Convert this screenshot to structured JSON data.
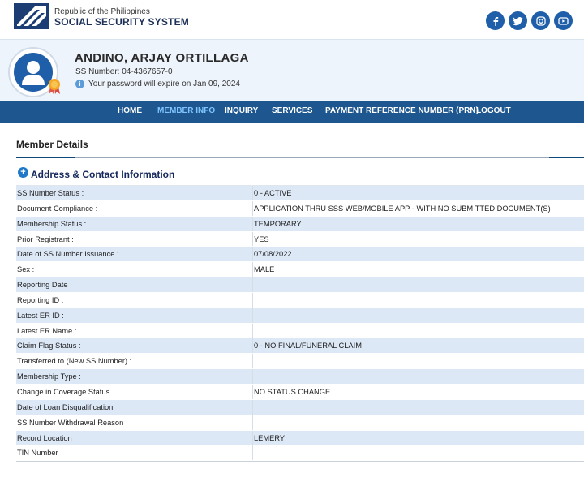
{
  "header": {
    "brand_line1": "Republic of the Philippines",
    "brand_line2": "SOCIAL SECURITY SYSTEM",
    "social_icons": [
      "facebook-icon",
      "twitter-icon",
      "instagram-icon",
      "youtube-icon"
    ]
  },
  "profile": {
    "name": "ANDINO, ARJAY ORTILLAGA",
    "ss_number": "SS Number: 04-4367657-0",
    "password_notice": "Your password will expire on Jan 09, 2024"
  },
  "nav": {
    "items": [
      {
        "label": "HOME"
      },
      {
        "label": "MEMBER INFO",
        "active": true
      },
      {
        "label": "INQUIRY"
      },
      {
        "label": "SERVICES"
      },
      {
        "label": "PAYMENT REFERENCE NUMBER (PRN)"
      },
      {
        "label": "LOGOUT"
      }
    ]
  },
  "main": {
    "section_title": "Member Details",
    "subsection_title": "Address & Contact Information",
    "rows": [
      {
        "label": "SS Number Status :",
        "value": "0 - ACTIVE"
      },
      {
        "label": "Document Compliance :",
        "value": "APPLICATION THRU SSS WEB/MOBILE APP - WITH NO SUBMITTED DOCUMENT(S)"
      },
      {
        "label": "Membership Status :",
        "value": "TEMPORARY"
      },
      {
        "label": "Prior Registrant :",
        "value": "YES"
      },
      {
        "label": "Date of SS Number Issuance :",
        "value": "07/08/2022"
      },
      {
        "label": "Sex :",
        "value": "MALE"
      },
      {
        "label": "Reporting Date :",
        "value": ""
      },
      {
        "label": "Reporting ID :",
        "value": ""
      },
      {
        "label": "Latest ER ID :",
        "value": ""
      },
      {
        "label": "Latest ER Name :",
        "value": ""
      },
      {
        "label": "Claim Flag Status :",
        "value": "0 - NO FINAL/FUNERAL CLAIM"
      },
      {
        "label": "Transferred to (New SS Number) :",
        "value": ""
      },
      {
        "label": "Membership Type :",
        "value": ""
      },
      {
        "label": "Change in Coverage Status",
        "value": "NO STATUS CHANGE"
      },
      {
        "label": "Date of Loan Disqualification",
        "value": ""
      },
      {
        "label": "SS Number Withdrawal Reason",
        "value": ""
      },
      {
        "label": "Record Location",
        "value": "LEMERY"
      },
      {
        "label": "TIN Number",
        "value": ""
      }
    ]
  },
  "colors": {
    "nav_bg": "#1e578f",
    "nav_active": "#7fc4ff",
    "row_alt": "#dde8f7",
    "profile_bg": "#eef4fb",
    "brand": "#1b2f57"
  }
}
